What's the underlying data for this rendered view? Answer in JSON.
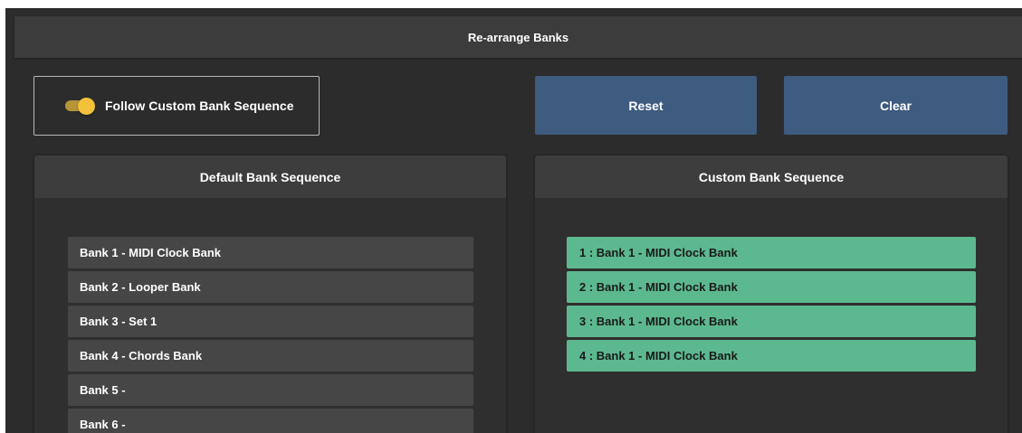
{
  "title": "Re-arrange Banks",
  "follow": {
    "label": "Follow Custom Bank Sequence",
    "enabled": true
  },
  "buttons": {
    "reset": "Reset",
    "clear": "Clear"
  },
  "default_sequence": {
    "header": "Default Bank Sequence",
    "items": [
      "Bank 1 - MIDI Clock Bank",
      "Bank 2 - Looper Bank",
      "Bank 3 - Set 1",
      "Bank 4 - Chords Bank",
      "Bank 5 -",
      "Bank 6 -"
    ]
  },
  "custom_sequence": {
    "header": "Custom Bank Sequence",
    "items": [
      "1 : Bank 1 - MIDI Clock Bank",
      "2 : Bank 1 - MIDI Clock Bank",
      "3 : Bank 1 - MIDI Clock Bank",
      "4 : Bank 1 - MIDI Clock Bank"
    ]
  },
  "colors": {
    "background": "#2c2c2c",
    "header": "#3c3c3c",
    "button": "#3e5b80",
    "toggle_on": "#f4c23a",
    "custom_item": "#5cb88f",
    "default_item": "#464646"
  }
}
